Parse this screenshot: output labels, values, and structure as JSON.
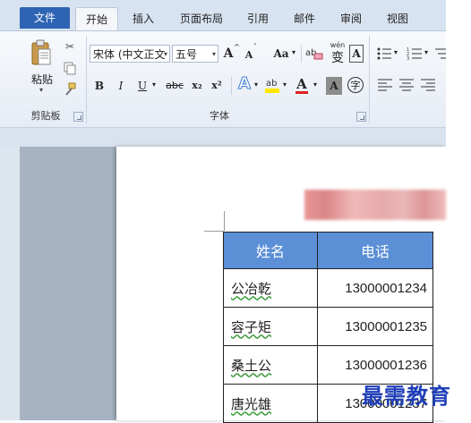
{
  "ribbon": {
    "tabs": {
      "file": "文件",
      "home": "开始",
      "insert": "插入",
      "page_layout": "页面布局",
      "references": "引用",
      "mailings": "邮件",
      "review": "审阅",
      "view": "视图"
    },
    "clipboard": {
      "group_label": "剪贴板",
      "paste_label": "粘贴"
    },
    "font": {
      "group_label": "字体",
      "font_name": "宋体 (中文正文",
      "font_size": "五号",
      "grow_label": "A",
      "shrink_label": "A",
      "change_case_label": "Aa",
      "clear_format_label": "ab",
      "phonetic_label": "wén",
      "border_char_label": "A",
      "bold_label": "B",
      "italic_label": "I",
      "underline_label": "U",
      "strike_label": "abc",
      "subscript_label": "x₂",
      "superscript_label": "x²",
      "text_effect_label": "A",
      "font_color_label": "A",
      "shade_label": "A",
      "enclose_label": "字"
    },
    "colors": {
      "file_tab": "#2f64b5",
      "highlight": "#ffe600",
      "font_color": "#e02020"
    }
  },
  "document": {
    "table": {
      "headers": [
        "姓名",
        "电话"
      ],
      "rows": [
        [
          "公冶乾",
          "13000001234"
        ],
        [
          "容子矩",
          "13000001235"
        ],
        [
          "桑土公",
          "13000001236"
        ],
        [
          "唐光雄",
          "13000001237"
        ]
      ],
      "header_color": "#5b8fd6"
    }
  },
  "watermark": "最需教育"
}
